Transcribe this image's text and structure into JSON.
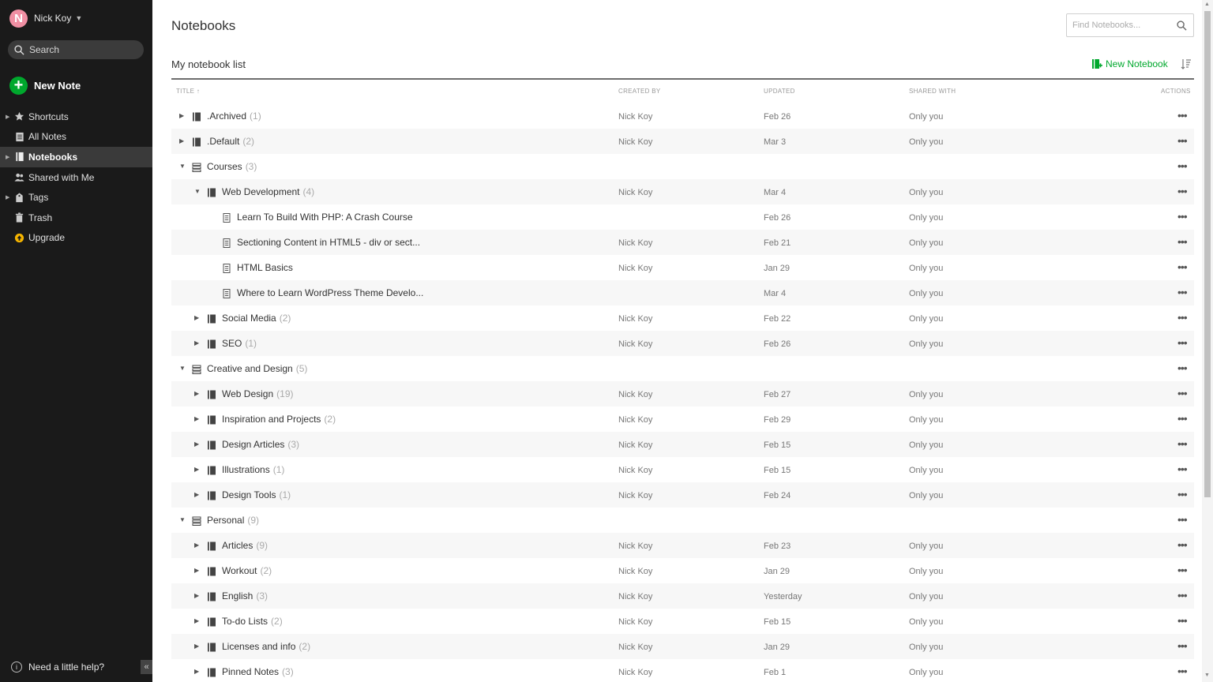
{
  "user": {
    "initial": "N",
    "name": "Nick Koy"
  },
  "sidebar": {
    "search_label": "Search",
    "new_note_label": "New Note",
    "items": [
      {
        "label": "Shortcuts",
        "icon": "star-icon",
        "caret": true
      },
      {
        "label": "All Notes",
        "icon": "note-icon",
        "caret": false
      },
      {
        "label": "Notebooks",
        "icon": "notebook-icon",
        "caret": true,
        "active": true
      },
      {
        "label": "Shared with Me",
        "icon": "people-icon",
        "caret": false
      },
      {
        "label": "Tags",
        "icon": "tag-icon",
        "caret": true
      },
      {
        "label": "Trash",
        "icon": "trash-icon",
        "caret": false
      },
      {
        "label": "Upgrade",
        "icon": "upgrade-icon",
        "caret": false
      }
    ],
    "help_label": "Need a little help?"
  },
  "main": {
    "page_title": "Notebooks",
    "find_placeholder": "Find Notebooks...",
    "list_title": "My notebook list",
    "new_notebook_label": "New Notebook",
    "columns": {
      "title": "TITLE",
      "created_by": "CREATED BY",
      "updated": "UPDATED",
      "shared_with": "SHARED WITH",
      "actions": "ACTIONS"
    }
  },
  "colors": {
    "accent": "#00a82d",
    "sidebar_bg": "#1a1a1a",
    "avatar": "#f08fa3"
  },
  "rows": [
    {
      "level": 0,
      "kind": "notebook",
      "expanded": false,
      "title": ".Archived",
      "count": "(1)",
      "created_by": "Nick Koy",
      "updated": "Feb 26",
      "shared_with": "Only you"
    },
    {
      "level": 0,
      "kind": "notebook",
      "expanded": false,
      "title": ".Default",
      "count": "(2)",
      "created_by": "Nick Koy",
      "updated": "Mar 3",
      "shared_with": "Only you"
    },
    {
      "level": 0,
      "kind": "stack",
      "expanded": true,
      "title": "Courses",
      "count": "(3)",
      "created_by": "",
      "updated": "",
      "shared_with": ""
    },
    {
      "level": 1,
      "kind": "notebook",
      "expanded": true,
      "title": "Web Development",
      "count": "(4)",
      "created_by": "Nick Koy",
      "updated": "Mar 4",
      "shared_with": "Only you"
    },
    {
      "level": 2,
      "kind": "note",
      "title": "Learn To Build With PHP: A Crash Course",
      "count": "",
      "created_by": "",
      "updated": "Feb 26",
      "shared_with": "Only you"
    },
    {
      "level": 2,
      "kind": "note",
      "title": "Sectioning Content in HTML5 - div or sect...",
      "count": "",
      "created_by": "Nick Koy",
      "updated": "Feb 21",
      "shared_with": "Only you"
    },
    {
      "level": 2,
      "kind": "note",
      "title": "HTML Basics",
      "count": "",
      "created_by": "Nick Koy",
      "updated": "Jan 29",
      "shared_with": "Only you"
    },
    {
      "level": 2,
      "kind": "note",
      "title": "Where to Learn WordPress Theme Develo...",
      "count": "",
      "created_by": "",
      "updated": "Mar 4",
      "shared_with": "Only you"
    },
    {
      "level": 1,
      "kind": "notebook",
      "expanded": false,
      "title": "Social Media",
      "count": "(2)",
      "created_by": "Nick Koy",
      "updated": "Feb 22",
      "shared_with": "Only you"
    },
    {
      "level": 1,
      "kind": "notebook",
      "expanded": false,
      "title": "SEO",
      "count": "(1)",
      "created_by": "Nick Koy",
      "updated": "Feb 26",
      "shared_with": "Only you"
    },
    {
      "level": 0,
      "kind": "stack",
      "expanded": true,
      "title": "Creative and Design",
      "count": "(5)",
      "created_by": "",
      "updated": "",
      "shared_with": ""
    },
    {
      "level": 1,
      "kind": "notebook",
      "expanded": false,
      "title": "Web Design",
      "count": "(19)",
      "created_by": "Nick Koy",
      "updated": "Feb 27",
      "shared_with": "Only you"
    },
    {
      "level": 1,
      "kind": "notebook",
      "expanded": false,
      "title": "Inspiration and Projects",
      "count": "(2)",
      "created_by": "Nick Koy",
      "updated": "Feb 29",
      "shared_with": "Only you"
    },
    {
      "level": 1,
      "kind": "notebook",
      "expanded": false,
      "title": "Design Articles",
      "count": "(3)",
      "created_by": "Nick Koy",
      "updated": "Feb 15",
      "shared_with": "Only you"
    },
    {
      "level": 1,
      "kind": "notebook",
      "expanded": false,
      "title": "Illustrations",
      "count": "(1)",
      "created_by": "Nick Koy",
      "updated": "Feb 15",
      "shared_with": "Only you"
    },
    {
      "level": 1,
      "kind": "notebook",
      "expanded": false,
      "title": "Design Tools",
      "count": "(1)",
      "created_by": "Nick Koy",
      "updated": "Feb 24",
      "shared_with": "Only you"
    },
    {
      "level": 0,
      "kind": "stack",
      "expanded": true,
      "title": "Personal",
      "count": "(9)",
      "created_by": "",
      "updated": "",
      "shared_with": ""
    },
    {
      "level": 1,
      "kind": "notebook",
      "expanded": false,
      "title": "Articles",
      "count": "(9)",
      "created_by": "Nick Koy",
      "updated": "Feb 23",
      "shared_with": "Only you"
    },
    {
      "level": 1,
      "kind": "notebook",
      "expanded": false,
      "title": "Workout",
      "count": "(2)",
      "created_by": "Nick Koy",
      "updated": "Jan 29",
      "shared_with": "Only you"
    },
    {
      "level": 1,
      "kind": "notebook",
      "expanded": false,
      "title": "English",
      "count": "(3)",
      "created_by": "Nick Koy",
      "updated": "Yesterday",
      "shared_with": "Only you"
    },
    {
      "level": 1,
      "kind": "notebook",
      "expanded": false,
      "title": "To-do Lists",
      "count": "(2)",
      "created_by": "Nick Koy",
      "updated": "Feb 15",
      "shared_with": "Only you"
    },
    {
      "level": 1,
      "kind": "notebook",
      "expanded": false,
      "title": "Licenses and info",
      "count": "(2)",
      "created_by": "Nick Koy",
      "updated": "Jan 29",
      "shared_with": "Only you"
    },
    {
      "level": 1,
      "kind": "notebook",
      "expanded": false,
      "title": "Pinned Notes",
      "count": "(3)",
      "created_by": "Nick Koy",
      "updated": "Feb 1",
      "shared_with": "Only you"
    }
  ]
}
